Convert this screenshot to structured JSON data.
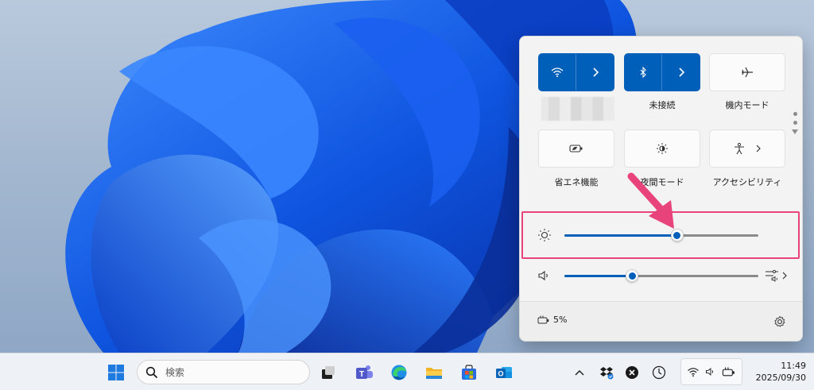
{
  "quick_settings": {
    "tiles": [
      {
        "id": "wifi",
        "label": "",
        "icon": "wifi-icon",
        "active": true,
        "has_chevron": true
      },
      {
        "id": "bluetooth",
        "label": "未接続",
        "icon": "bluetooth-icon",
        "active": true,
        "has_chevron": true
      },
      {
        "id": "airplane",
        "label": "機内モード",
        "icon": "airplane-icon",
        "active": false
      },
      {
        "id": "battery-saver",
        "label": "省エネ機能",
        "icon": "battery-saver-icon",
        "active": false
      },
      {
        "id": "night-light",
        "label": "夜間モード",
        "icon": "night-light-icon",
        "active": false
      },
      {
        "id": "accessibility",
        "label": "アクセシビリティ",
        "icon": "accessibility-icon",
        "active": false,
        "has_chevron": true
      }
    ],
    "brightness": {
      "icon": "brightness-icon",
      "level": 0.58
    },
    "volume": {
      "icon": "speaker-icon",
      "level": 0.35
    },
    "footer": {
      "battery_text": "5%",
      "battery_icon": "battery-charging-icon",
      "settings_icon": "gear-icon"
    }
  },
  "annotation": {
    "color": "#e8437a"
  },
  "taskbar": {
    "search_placeholder": "検索",
    "apps": [
      "start-icon",
      "task-view-icon",
      "teams-icon",
      "edge-icon",
      "file-explorer-icon",
      "store-icon",
      "outlook-icon"
    ],
    "tray": {
      "overflow_icon": "chevron-up-icon",
      "clock_time": "11:49",
      "clock_date": "2025/09/30"
    }
  },
  "colors": {
    "accent": "#005fb8",
    "panel": "#f3f3f3",
    "taskbar": "#eef1f5"
  }
}
